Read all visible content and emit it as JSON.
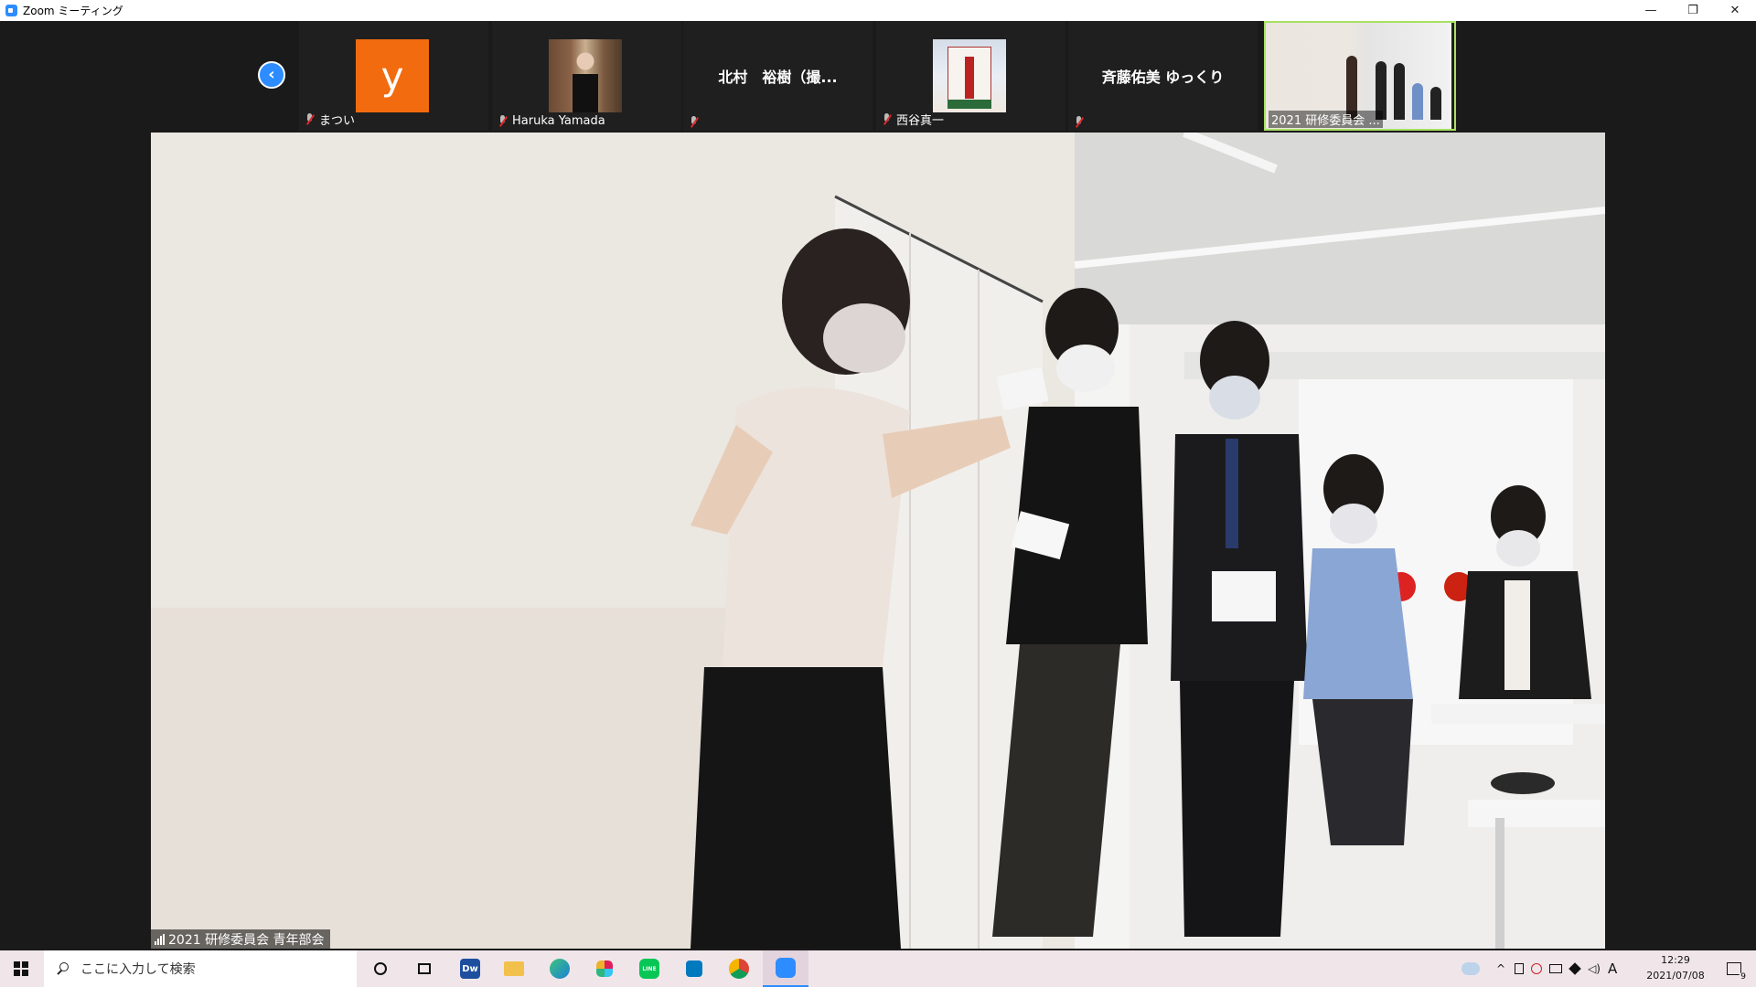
{
  "window": {
    "title": "Zoom ミーティング",
    "minimize": "—",
    "restore": "❐",
    "close": "✕"
  },
  "strip": {
    "prev_page_icon": "‹",
    "participants": [
      {
        "name": "まつい",
        "display": "avatar",
        "avatar_letter": "y",
        "avatar_color": "#f26b0f",
        "muted": true
      },
      {
        "name": "Haruka Yamada",
        "display": "photo",
        "muted": true
      },
      {
        "name": "",
        "center_name": "北村　裕樹（撮...",
        "display": "name",
        "muted": true
      },
      {
        "name": "西谷真一",
        "display": "photo",
        "muted": true
      },
      {
        "name": "",
        "center_name": "斉藤佑美 ゆっくり",
        "display": "name",
        "muted": true
      },
      {
        "name": "2021 研修委員会 ...",
        "display": "video",
        "active": true,
        "muted": false
      }
    ]
  },
  "main_video": {
    "label": "2021 研修委員会 青年部会"
  },
  "taskbar": {
    "search_placeholder": "ここに入力して検索",
    "apps": [
      "cortana-icon",
      "task-view-icon",
      "dreamweaver-icon",
      "file-explorer-icon",
      "edge-icon",
      "slack-icon",
      "line-icon",
      "trello-icon",
      "chrome-icon",
      "zoom-icon"
    ],
    "app_labels": {
      "dreamweaver": "Dw",
      "line": "LINE"
    },
    "ime": "A",
    "time": "12:29",
    "date": "2021/07/08",
    "notification_count": "9"
  },
  "colors": {
    "accent": "#2d8cff",
    "active_speaker": "#a8e063",
    "muted": "#e02828"
  }
}
